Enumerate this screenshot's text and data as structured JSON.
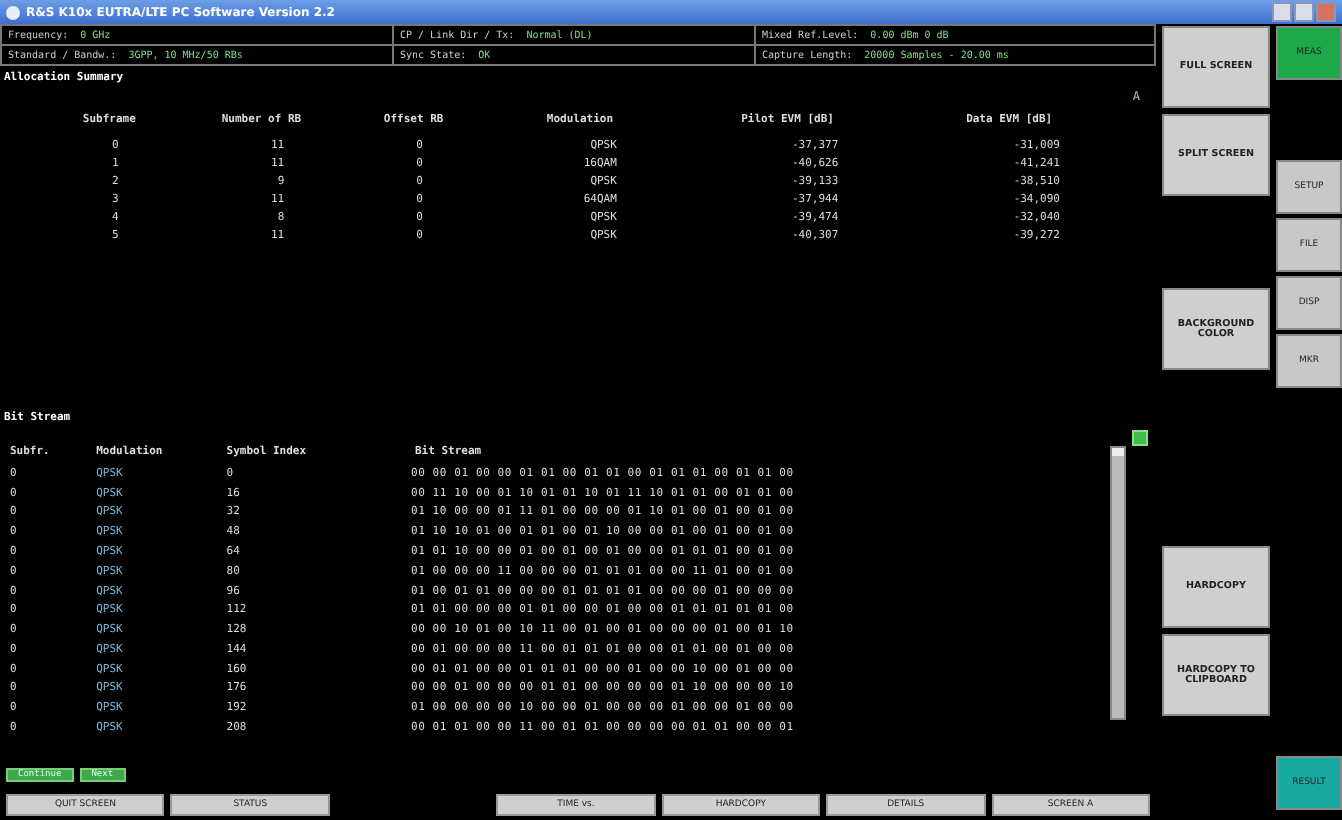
{
  "window": {
    "title": "R&S K10x EUTRA/LTE PC Software Version 2.2"
  },
  "header": [
    {
      "label": "Frequency:",
      "value": "0 GHz"
    },
    {
      "label": "CP / Link Dir / Tx:",
      "value": "Normal (DL)"
    },
    {
      "label": "Mixed Ref.Level:",
      "value": "0.00 dBm 0 dB"
    },
    {
      "label": "Standard / Bandw.:",
      "value": "3GPP, 10 MHz/50 RBs"
    },
    {
      "label": "Sync State:",
      "value": "OK"
    },
    {
      "label": "Capture Length:",
      "value": "20000 Samples - 20.00 ms"
    }
  ],
  "allocation_summary": {
    "title": "Allocation Summary",
    "marker": "A",
    "columns": [
      "Subframe",
      "Number of RB",
      "Offset RB",
      "Modulation",
      "Pilot EVM [dB]",
      "Data EVM [dB]"
    ],
    "rows": [
      [
        "0",
        "11",
        "0",
        "QPSK",
        "-37,377",
        "-31,009"
      ],
      [
        "1",
        "11",
        "0",
        "16QAM",
        "-40,626",
        "-41,241"
      ],
      [
        "2",
        "9",
        "0",
        "QPSK",
        "-39,133",
        "-38,510"
      ],
      [
        "3",
        "11",
        "0",
        "64QAM",
        "-37,944",
        "-34,090"
      ],
      [
        "4",
        "8",
        "0",
        "QPSK",
        "-39,474",
        "-32,040"
      ],
      [
        "5",
        "11",
        "0",
        "QPSK",
        "-40,307",
        "-39,272"
      ]
    ]
  },
  "bit_stream": {
    "title": "Bit Stream",
    "columns": [
      "Subfr.",
      "Modulation",
      "Symbol Index",
      "Bit Stream"
    ],
    "rows": [
      [
        "0",
        "QPSK",
        "0",
        "00 00 01 00 00 01 01 00 01 01 00 01 01 01 00 01 01 00"
      ],
      [
        "0",
        "QPSK",
        "16",
        "00 11 10 00 01 10 01 01 10 01 11 10 01 01 00 01 01 00"
      ],
      [
        "0",
        "QPSK",
        "32",
        "01 10 00 00 01 11 01 00 00 00 01 10 01 00 01 00 01 00"
      ],
      [
        "0",
        "QPSK",
        "48",
        "01 10 10 01 00 01 01 00 01 10 00 00 01 00 01 00 01 00"
      ],
      [
        "0",
        "QPSK",
        "64",
        "01 01 10 00 00 01 00 01 00 01 00 00 01 01 01 00 01 00"
      ],
      [
        "0",
        "QPSK",
        "80",
        "01 00 00 00 11 00 00 00 01 01 01 00 00 11 01 00 01 00"
      ],
      [
        "0",
        "QPSK",
        "96",
        "01 00 01 01 00 00 00 01 01 01 01 00 00 00 01 00 00 00"
      ],
      [
        "0",
        "QPSK",
        "112",
        "01 01 00 00 00 01 01 00 00 01 00 00 01 01 01 01 01 00"
      ],
      [
        "0",
        "QPSK",
        "128",
        "00 00 10 01 00 10 11 00 01 00 01 00 00 00 01 00 01 10"
      ],
      [
        "0",
        "QPSK",
        "144",
        "00 01 00 00 00 11 00 01 01 01 00 00 01 01 00 01 00 00"
      ],
      [
        "0",
        "QPSK",
        "160",
        "00 01 01 00 00 01 01 01 00 00 01 00 00 10 00 01 00 00"
      ],
      [
        "0",
        "QPSK",
        "176",
        "00 00 01 00 00 00 01 01 00 00 00 00 01 10 00 00 00 10"
      ],
      [
        "0",
        "QPSK",
        "192",
        "01 00 00 00 00 10 00 00 01 00 00 00 01 00 00 01 00 00"
      ],
      [
        "0",
        "QPSK",
        "208",
        "00 01 01 00 00 11 00 01 01 00 00 00 00 01 01 00 00 01"
      ]
    ],
    "actions": [
      {
        "label": "Continue",
        "color": "#3da94a"
      },
      {
        "label": "Next",
        "color": "#3da94a"
      }
    ]
  },
  "bottom_softkeys": [
    {
      "kind": "key",
      "label": "QUIT SCREEN"
    },
    {
      "kind": "key",
      "label": "STATUS"
    },
    {
      "kind": "blank"
    },
    {
      "kind": "key",
      "label": "TIME vs."
    },
    {
      "kind": "key",
      "label": "HARDCOPY"
    },
    {
      "kind": "key",
      "label": "DETAILS"
    },
    {
      "kind": "key",
      "label": "SCREEN A"
    }
  ],
  "side_softkeys": [
    "FULL SCREEN",
    "SPLIT SCREEN",
    "BACKGROUND COLOR",
    "HARDCOPY",
    "HARDCOPY TO CLIPBOARD"
  ],
  "menu_keys": [
    {
      "label": "MEAS",
      "color": "#1ea84a"
    },
    {
      "label": "SETUP",
      "color": "#c8c8c8"
    },
    {
      "label": "FILE",
      "color": "#c8c8c8"
    },
    {
      "label": "DISP",
      "color": "#c8c8c8"
    },
    {
      "label": "MKR",
      "color": "#c8c8c8"
    },
    {
      "label": "RESULT",
      "color": "#1aa9a0"
    }
  ]
}
